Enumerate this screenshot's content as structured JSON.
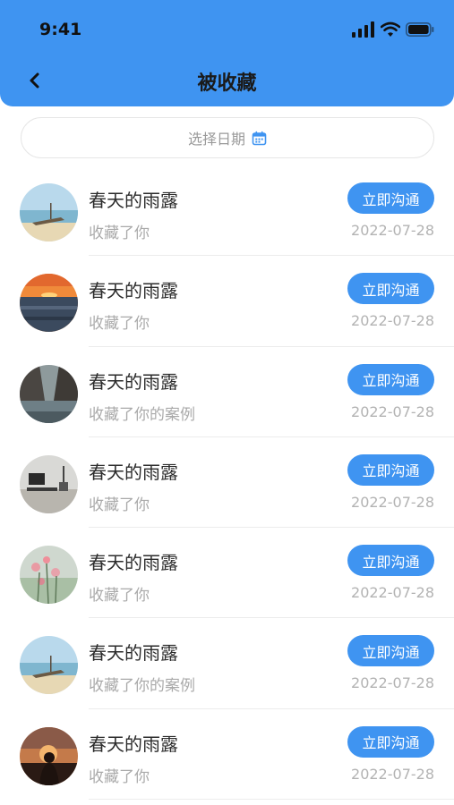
{
  "status_bar": {
    "time": "9:41"
  },
  "nav": {
    "title": "被收藏"
  },
  "filter": {
    "date_label": "选择日期"
  },
  "colors": {
    "accent": "#3f94f1"
  },
  "items": [
    {
      "name": "春天的雨露",
      "action": "收藏了你",
      "date": "2022-07-28",
      "button": "立即沟通",
      "avatar": "beach-boat-avatar"
    },
    {
      "name": "春天的雨露",
      "action": "收藏了你",
      "date": "2022-07-28",
      "button": "立即沟通",
      "avatar": "sunset-sea-avatar"
    },
    {
      "name": "春天的雨露",
      "action": "收藏了你的案例",
      "date": "2022-07-28",
      "button": "立即沟通",
      "avatar": "mountain-lake-avatar"
    },
    {
      "name": "春天的雨露",
      "action": "收藏了你",
      "date": "2022-07-28",
      "button": "立即沟通",
      "avatar": "desk-workspace-avatar"
    },
    {
      "name": "春天的雨露",
      "action": "收藏了你",
      "date": "2022-07-28",
      "button": "立即沟通",
      "avatar": "pink-flowers-avatar"
    },
    {
      "name": "春天的雨露",
      "action": "收藏了你的案例",
      "date": "2022-07-28",
      "button": "立即沟通",
      "avatar": "beach-boat-avatar"
    },
    {
      "name": "春天的雨露",
      "action": "收藏了你",
      "date": "2022-07-28",
      "button": "立即沟通",
      "avatar": "sunset-silhouette-avatar"
    }
  ]
}
